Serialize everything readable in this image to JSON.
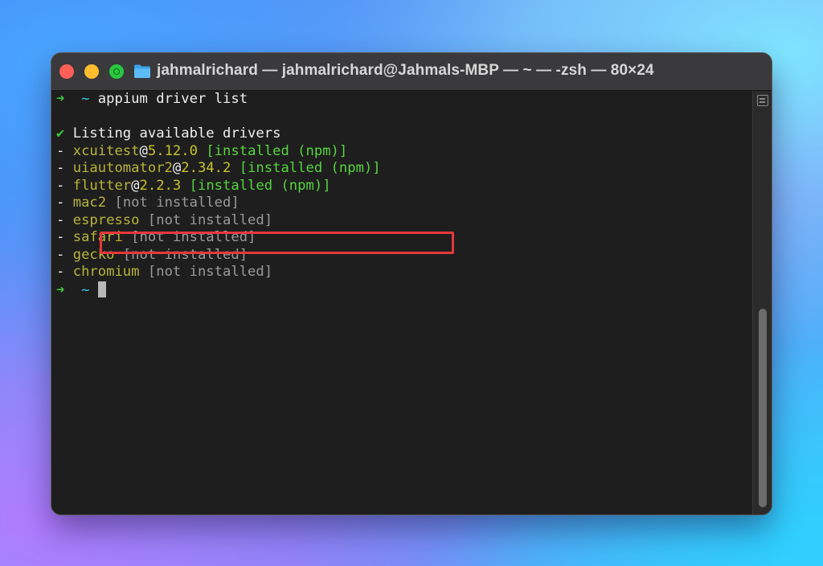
{
  "window": {
    "title": "jahmalrichard — jahmalrichard@Jahmals-MBP — ~ — -zsh — 80×24"
  },
  "terminal": {
    "prompt_arrow": "➜",
    "prompt_dir": "~",
    "command": "appium driver list",
    "check_mark": "✔",
    "heading": "Listing available drivers",
    "dash": "-",
    "drivers": [
      {
        "name": "xcuitest",
        "at": "@",
        "version": "5.12.0",
        "status": "[installed (npm)]"
      },
      {
        "name": "uiautomator2",
        "at": "@",
        "version": "2.34.2",
        "status": "[installed (npm)]"
      },
      {
        "name": "flutter",
        "at": "@",
        "version": "2.2.3",
        "status": "[installed (npm)]"
      },
      {
        "name": "mac2",
        "status": "[not installed]"
      },
      {
        "name": "espresso",
        "status": "[not installed]"
      },
      {
        "name": "safari",
        "status": "[not installed]"
      },
      {
        "name": "gecko",
        "status": "[not installed]"
      },
      {
        "name": "chromium",
        "status": "[not installed]"
      }
    ]
  },
  "colors": {
    "highlight_box": "#e5383b",
    "prompt_green": "#3ec43a",
    "prompt_cyan": "#39c8e8"
  },
  "icons": {
    "folder": "folder-icon",
    "scroll_menu": "scroll-menu-icon"
  }
}
